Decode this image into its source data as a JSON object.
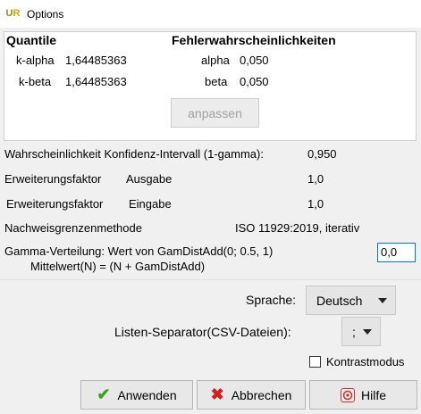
{
  "window": {
    "title": "Options",
    "icon_text": "UR"
  },
  "quantile": {
    "heading": "Quantile",
    "k_alpha_label": "k-alpha",
    "k_alpha_value": "1,64485363",
    "k_beta_label": "k-beta",
    "k_beta_value": "1,64485363"
  },
  "error_probabilities": {
    "heading": "Fehlerwahrscheinlichkeiten",
    "alpha_label": "alpha",
    "alpha_value": "0,050",
    "beta_label": "beta",
    "beta_value": "0,050"
  },
  "adjust_button": "anpassen",
  "confidence_interval": {
    "label": "Wahrscheinlichkeit Konfidenz-Intervall (1-gamma):",
    "value": "0,950"
  },
  "expansion_output": {
    "label_a": "Erweiterungsfaktor",
    "label_b": "Ausgabe",
    "value": "1,0"
  },
  "expansion_input": {
    "label_a": "Erweiterungsfaktor",
    "label_b": "Eingabe",
    "value": "1,0"
  },
  "detection_limit": {
    "label": "Nachweisgrenzenmethode",
    "value": "ISO 11929:2019, iterativ"
  },
  "gamma": {
    "line1": "Gamma-Verteilung: Wert von GamDistAdd(0; 0.5, 1)",
    "line2": "Mittelwert(N) = (N + GamDistAdd)",
    "input_value": "0,0"
  },
  "language": {
    "label": "Sprache:",
    "selected": "Deutsch"
  },
  "csv_separator": {
    "label": "Listen-Separator(CSV-Dateien):",
    "selected": ";"
  },
  "contrast_mode": {
    "label": "Kontrastmodus",
    "checked": false
  },
  "buttons": {
    "apply": "Anwenden",
    "cancel": "Abbrechen",
    "help": "Hilfe"
  },
  "colors": {
    "check_green": "#3aa020",
    "cancel_red": "#d02020",
    "help_red": "#c83030",
    "focus_blue": "#0078d7"
  }
}
